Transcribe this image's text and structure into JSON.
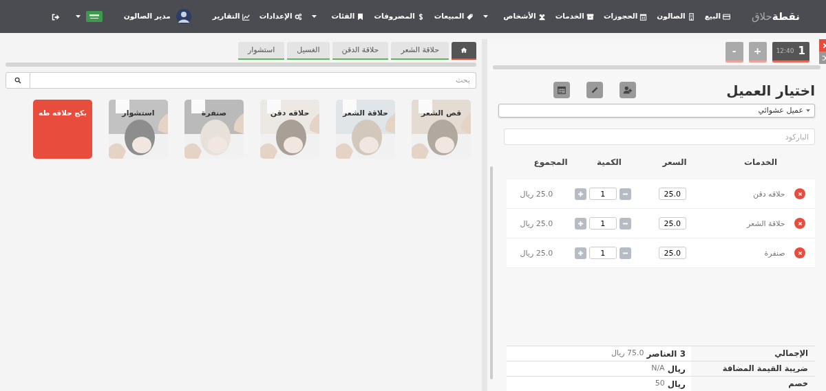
{
  "navbar": {
    "logo": {
      "bold": "نقطة",
      "light": "حلاق"
    },
    "items": [
      {
        "label": "البيع",
        "dropdown": false
      },
      {
        "label": "الصالون",
        "dropdown": false
      },
      {
        "label": "الحجوزات",
        "dropdown": false
      },
      {
        "label": "الخدمات",
        "dropdown": false
      },
      {
        "label": "الأشخاص",
        "dropdown": true
      },
      {
        "label": "المبيعات",
        "dropdown": false
      },
      {
        "label": "المصروفات",
        "dropdown": false
      },
      {
        "label": "الفئات",
        "dropdown": true
      },
      {
        "label": "الإعدادات",
        "dropdown": false
      },
      {
        "label": "التقارير",
        "dropdown": false
      }
    ],
    "user": "مدير الصالون"
  },
  "order_tabs": [
    {
      "number": "1",
      "time": "12:40",
      "selected": true
    }
  ],
  "order_buttons": [
    "+",
    "-"
  ],
  "customer": {
    "title": "اختيار العميل",
    "select": "عميل عشوائي",
    "barcode_placeholder": "الباركود"
  },
  "cart": {
    "columns": [
      "الخدمات",
      "السعر",
      "الكمية",
      "المجموع"
    ],
    "rows": [
      {
        "service": "حلاقه دقن",
        "price": "25.0",
        "quantity": "1",
        "total": "25.0 ريال"
      },
      {
        "service": "حلاقة الشعر",
        "price": "25.0",
        "quantity": "1",
        "total": "25.0 ريال"
      },
      {
        "service": "صنفرة",
        "price": "25.0",
        "quantity": "1",
        "total": "25.0 ريال"
      }
    ]
  },
  "totals": [
    {
      "label": "الإجمالي",
      "strong": "3 العناصر",
      "value": "75.0 ريال"
    },
    {
      "label": "ضريبة القيمة المضافة",
      "strong": "ريال",
      "value": "N/A"
    },
    {
      "label": "خصم",
      "strong": "ريال",
      "value": "50"
    }
  ],
  "categories": [
    {
      "kind": "home",
      "selected": true
    },
    {
      "kind": "text",
      "label": "حلاقة الشعر",
      "selected": false
    },
    {
      "kind": "text",
      "label": "حلاقة الدقن",
      "selected": false
    },
    {
      "kind": "text",
      "label": "الغسيل",
      "selected": false
    },
    {
      "kind": "text",
      "label": "استشوار",
      "selected": false
    }
  ],
  "search": {
    "placeholder": "بحث"
  },
  "products": [
    {
      "name": "قص الشعر",
      "kind": "picture"
    },
    {
      "name": "حلاقة الشعر",
      "kind": "picture"
    },
    {
      "name": "حلاقه دقن",
      "kind": "picture"
    },
    {
      "name": "صنفرة",
      "kind": "picture"
    },
    {
      "name": "استشوار",
      "kind": "picture"
    },
    {
      "name": "بكج حلاقه طه",
      "kind": "package"
    }
  ]
}
